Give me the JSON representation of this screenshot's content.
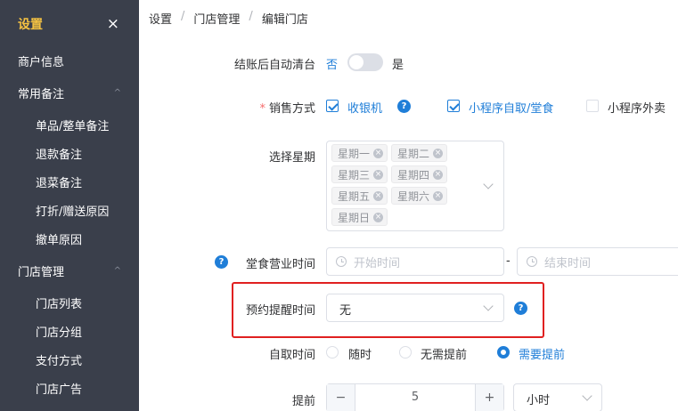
{
  "sidebar": {
    "title": "设置",
    "close_icon": "×",
    "items": [
      {
        "label": "商户信息",
        "type": "top"
      },
      {
        "label": "常用备注",
        "type": "group"
      },
      {
        "label": "单品/整单备注",
        "type": "sub"
      },
      {
        "label": "退款备注",
        "type": "sub"
      },
      {
        "label": "退菜备注",
        "type": "sub"
      },
      {
        "label": "打折/赠送原因",
        "type": "sub"
      },
      {
        "label": "撤单原因",
        "type": "sub"
      },
      {
        "label": "门店管理",
        "type": "group"
      },
      {
        "label": "门店列表",
        "type": "sub"
      },
      {
        "label": "门店分组",
        "type": "sub"
      },
      {
        "label": "支付方式",
        "type": "sub"
      },
      {
        "label": "门店广告",
        "type": "sub"
      }
    ],
    "group_arrow": "^"
  },
  "breadcrumb": {
    "items": [
      "设置",
      "门店管理",
      "编辑门店"
    ],
    "separator": "/"
  },
  "form": {
    "auto_clear": {
      "label": "结账后自动清台",
      "off_text": "否",
      "on_text": "是",
      "enabled": false
    },
    "sales_method": {
      "required_mark": "*",
      "label": "销售方式",
      "options": [
        {
          "label": "收银机",
          "checked": true
        },
        {
          "label": "小程序自取/堂食",
          "checked": true
        },
        {
          "label": "小程序外卖",
          "checked": false
        }
      ],
      "help_icon": "?"
    },
    "weekdays": {
      "label": "选择星期",
      "selected": [
        "星期一",
        "星期二",
        "星期三",
        "星期四",
        "星期五",
        "星期六",
        "星期日"
      ],
      "tag_close": "×"
    },
    "dine_hours": {
      "help_icon": "?",
      "label": "堂食营业时间",
      "start_placeholder": "开始时间",
      "end_placeholder": "结束时间",
      "range_separator": "-"
    },
    "reminder": {
      "label": "预约提醒时间",
      "value": "无",
      "help_icon": "?"
    },
    "pickup_time": {
      "label": "自取时间",
      "options": [
        {
          "label": "随时",
          "checked": false
        },
        {
          "label": "无需提前",
          "checked": false
        },
        {
          "label": "需要提前",
          "checked": true
        }
      ]
    },
    "advance": {
      "label": "提前",
      "minus": "−",
      "value": "5",
      "plus": "+",
      "unit": "小时"
    }
  },
  "colors": {
    "accent": "#1f7ed8",
    "sidebar_bg": "#3a3f4b",
    "sidebar_title": "#f5c242",
    "highlight": "#e02020"
  }
}
